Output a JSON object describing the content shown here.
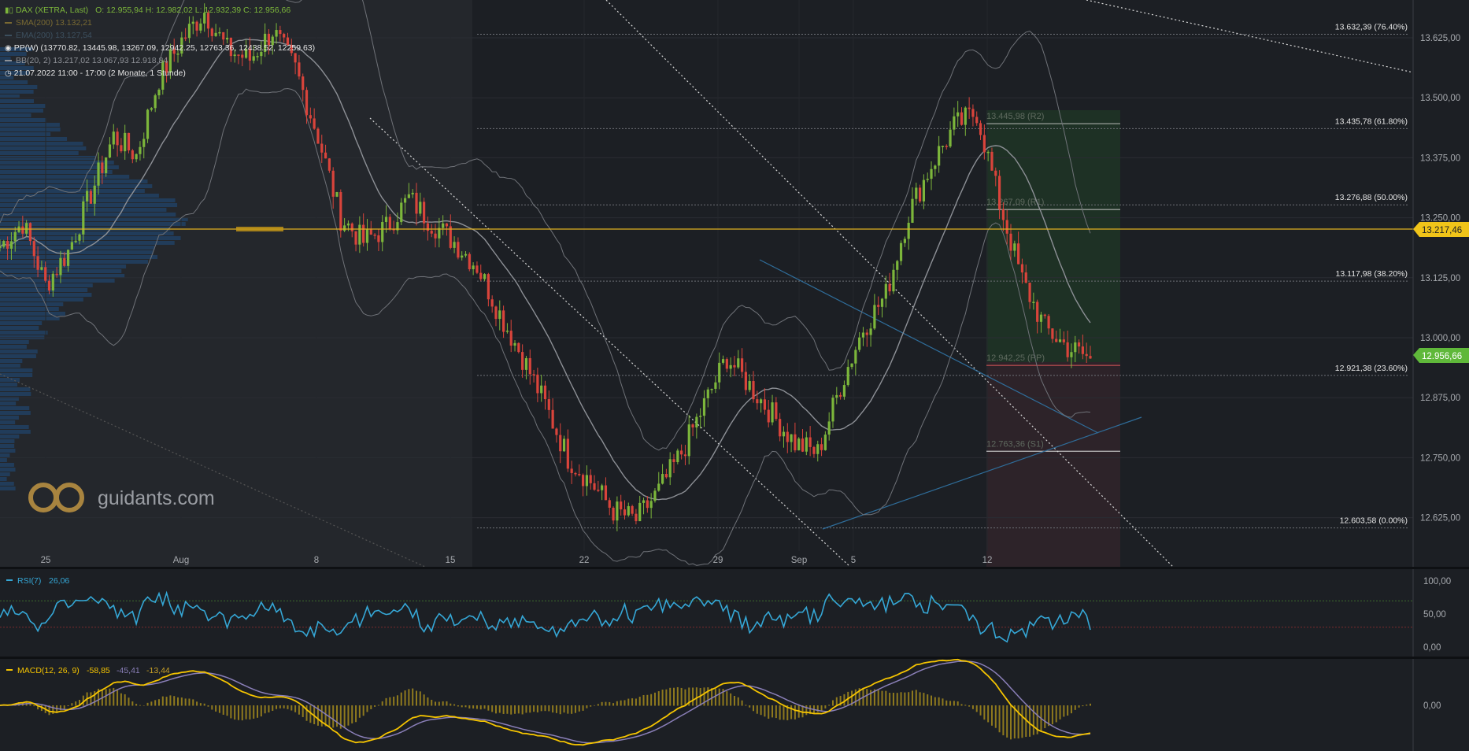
{
  "instrument": {
    "name": "DAX (XETRA, Last)",
    "ohlc": "O: 12.955,94  H: 12.982,02  L: 12.932,39  C: 12.956,66"
  },
  "indicators": {
    "sma": "SMA(200)  13.132,21",
    "ema": "EMA(200)  13.127,54",
    "pp": "PP(W)  (13770.82, 13445.98, 13267.09, 12942.25, 12763.36, 12438.52, 12259.63)",
    "bb": "BB(20, 2)  13.217,02  13.067,93  12.918,84",
    "range": "21.07.2022 11:00 - 17:00   (2 Monate, 1 Stunde)"
  },
  "brand": {
    "name": "guidants.com"
  },
  "price_axis": {
    "ticks": [
      "13.625,00",
      "13.500,00",
      "13.375,00",
      "13.250,00",
      "13.125,00",
      "13.000,00",
      "12.875,00",
      "12.750,00",
      "12.625,00"
    ],
    "marker_yellow": "13.217,46",
    "marker_green": "12.956,66"
  },
  "fib_levels": [
    "13.632,39 (76.40%)",
    "13.435,78 (61.80%)",
    "13.276,88 (50.00%)",
    "13.117,98 (38.20%)",
    "12.921,38 (23.60%)",
    "12.603,58 (0.00%)"
  ],
  "pivot_labels": [
    "13.445,98 (R2)",
    "13.267,09 (R1)",
    "12.942,25 (PP)",
    "12.763,36 (S1)"
  ],
  "time_axis": [
    "25",
    "Aug",
    "8",
    "15",
    "22",
    "29",
    "Sep",
    "5",
    "12"
  ],
  "rsi": {
    "label": "RSI(7)",
    "value": "26,06",
    "ticks": [
      "100,00",
      "50,00",
      "0,00"
    ]
  },
  "macd": {
    "label": "MACD(12, 26, 9)",
    "v1": "-58,85",
    "v2": "-45,41",
    "v3": "-13,44",
    "tick": "0,00"
  },
  "chart_data": {
    "type": "line",
    "title": "DAX (XETRA, Last)",
    "timeframe": "1 Stunde",
    "x_ticks": [
      "25",
      "Aug",
      "8",
      "15",
      "22",
      "29",
      "Sep",
      "5",
      "12"
    ],
    "ylim": [
      12580,
      13680
    ],
    "close_approx": [
      13190,
      13240,
      13110,
      13180,
      13300,
      13420,
      13380,
      13540,
      13620,
      13680,
      13600,
      13580,
      13640,
      13560,
      13420,
      13250,
      13200,
      13230,
      13290,
      13240,
      13200,
      13150,
      13050,
      12960,
      12860,
      12750,
      12700,
      12640,
      12620,
      12680,
      12760,
      12860,
      12960,
      12900,
      12840,
      12780,
      12760,
      12900,
      13020,
      13090,
      13260,
      13360,
      13440,
      13470,
      13280,
      13120,
      13020,
      12980,
      12956.66
    ],
    "last": 12956.66,
    "horizontal_line": 13217.46,
    "fibonacci": [
      {
        "level": 13632.39,
        "pct": "76.40%"
      },
      {
        "level": 13435.78,
        "pct": "61.80%"
      },
      {
        "level": 13276.88,
        "pct": "50.00%"
      },
      {
        "level": 13117.98,
        "pct": "38.20%"
      },
      {
        "level": 12921.38,
        "pct": "23.60%"
      },
      {
        "level": 12603.58,
        "pct": "0.00%"
      }
    ],
    "pivots": {
      "R2": 13445.98,
      "R1": 13267.09,
      "PP": 12942.25,
      "S1": 12763.36
    },
    "rsi_last": 26.06,
    "macd_last": {
      "macd": -58.85,
      "signal": -45.41,
      "hist": -13.44
    }
  },
  "colors": {
    "up": "#7cb63b",
    "down": "#d9443b",
    "accent": "#f0c419",
    "rsi": "#35a7d6",
    "macd": "#f5c400",
    "signal": "#8a7fb8"
  }
}
